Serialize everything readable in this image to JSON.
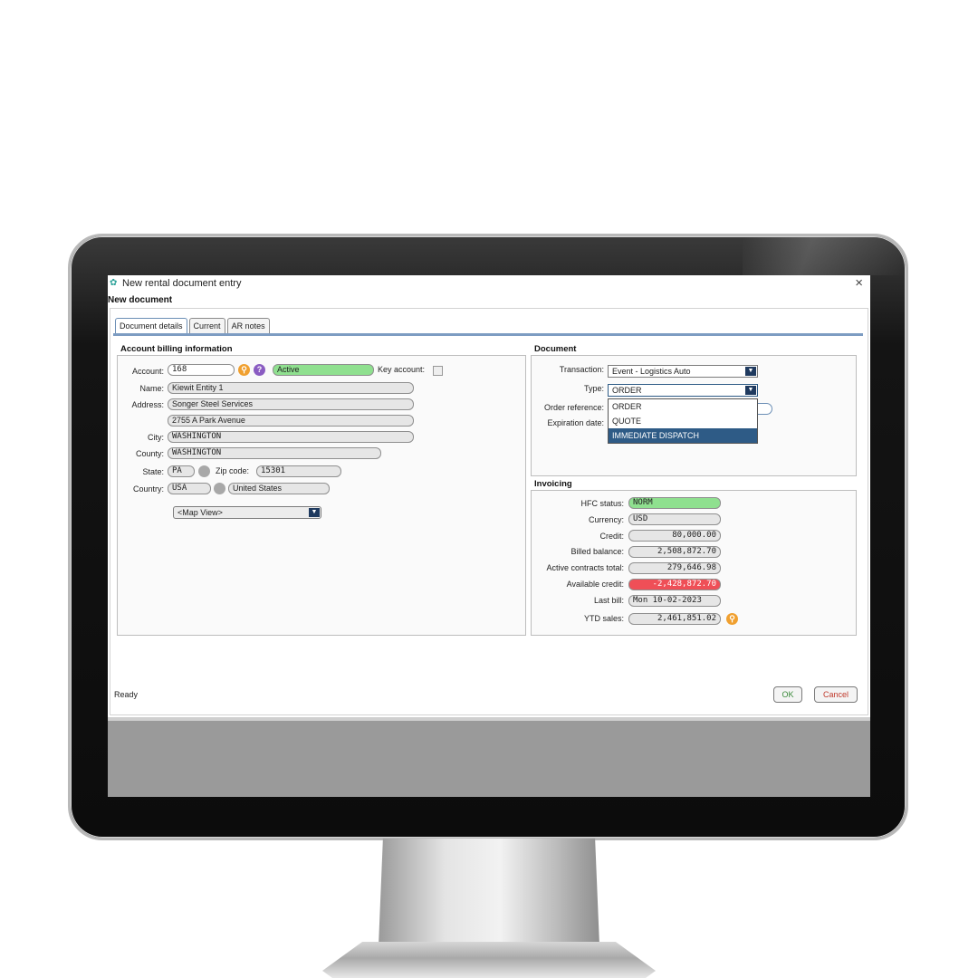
{
  "window": {
    "title": "New rental document entry",
    "subtitle": "New document",
    "close_label": "×"
  },
  "tabs": [
    {
      "label": "Document details",
      "active": true
    },
    {
      "label": "Current",
      "active": false
    },
    {
      "label": "AR notes",
      "active": false
    }
  ],
  "account_billing": {
    "section_title": "Account billing information",
    "account_label": "Account:",
    "account_value": "168",
    "status_value": "Active",
    "key_account_label": "Key account:",
    "name_label": "Name:",
    "name_value": "Kiewit Entity 1",
    "address_label": "Address:",
    "address_line1": "Songer Steel Services",
    "address_line2": "2755 A Park Avenue",
    "city_label": "City:",
    "city_value": "WASHINGTON",
    "county_label": "County:",
    "county_value": "WASHINGTON",
    "state_label": "State:",
    "state_value": "PA",
    "zip_label": "Zip code:",
    "zip_value": "15301",
    "country_label": "Country:",
    "country_code": "USA",
    "country_name": "United States",
    "map_view": "<Map View>"
  },
  "document": {
    "section_title": "Document",
    "transaction_label": "Transaction:",
    "transaction_value": "Event - Logistics Auto",
    "type_label": "Type:",
    "type_value": "ORDER",
    "order_reference_label": "Order reference:",
    "expiration_date_label": "Expiration date:",
    "type_options": [
      "ORDER",
      "QUOTE",
      "IMMEDIATE DISPATCH"
    ],
    "highlighted_option": "IMMEDIATE DISPATCH"
  },
  "invoicing": {
    "section_title": "Invoicing",
    "hfc_status_label": "HFC status:",
    "hfc_status_value": "NORM",
    "currency_label": "Currency:",
    "currency_value": "USD",
    "credit_label": "Credit:",
    "credit_value": "80,000.00",
    "billed_balance_label": "Billed balance:",
    "billed_balance_value": "2,508,872.70",
    "active_contracts_label": "Active contracts total:",
    "active_contracts_value": "279,646.98",
    "available_credit_label": "Available credit:",
    "available_credit_value": "-2,428,872.70",
    "last_bill_label": "Last bill:",
    "last_bill_value": "Mon 10-02-2023",
    "ytd_sales_label": "YTD sales:",
    "ytd_sales_value": "2,461,851.02"
  },
  "footer": {
    "status": "Ready",
    "ok_label": "OK",
    "cancel_label": "Cancel"
  },
  "colors": {
    "status_green": "#8fe08f",
    "alert_red": "#ef4f57",
    "tab_accent": "#7d9cc2",
    "selection_blue": "#2e5b86",
    "lookup_orange": "#f0a030",
    "help_purple": "#8a5cc2"
  }
}
